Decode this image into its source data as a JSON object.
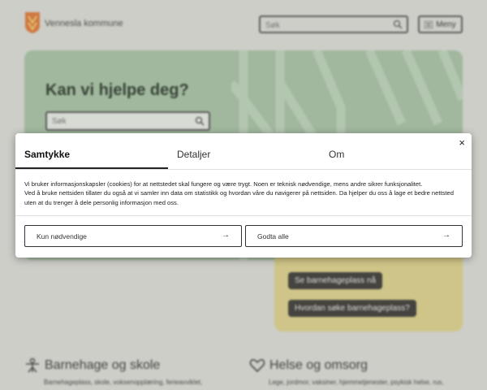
{
  "header": {
    "site_name": "Vennesla kommune",
    "search_placeholder": "Søk",
    "menu_label": "Meny"
  },
  "hero": {
    "title": "Kan vi hjelpe deg?",
    "search_placeholder": "Søk"
  },
  "promo": {
    "links": [
      "Se barnehageplass nå",
      "Hvordan søke barnehageplass?"
    ]
  },
  "categories": [
    {
      "title": "Barnehage og skole",
      "subtitle": "Barnehageplass, skole, voksenopplæring, ferieavviklet,"
    },
    {
      "title": "Helse og omsorg",
      "subtitle": "Lege, jordmor, vaksiner, hjemmetjenester, psykisk helse, rus,"
    }
  ],
  "consent": {
    "tabs": [
      "Samtykke",
      "Detaljer",
      "Om"
    ],
    "paragraph1": "Vi bruker informasjonskapsler (cookies) for at nettstedet skal fungere og være trygt. Noen er teknisk nødvendige, mens andre sikrer funksjonalitet.",
    "paragraph2": "Ved å bruke nettsiden tillater du også at vi samler inn data om statistikk og hvordan våre du navigerer på nettsiden. Da hjelper du oss å lage et bedre nettsted uten at du trenger å dele personlig informasjon med oss.",
    "button_necessary": "Kun nødvendige",
    "button_accept": "Godta alle",
    "close": "×",
    "arrow": "→"
  },
  "colors": {
    "hero_green": "#a8c4a6",
    "promo_yellow": "#ded38d",
    "dark_button": "#3d3b37"
  }
}
